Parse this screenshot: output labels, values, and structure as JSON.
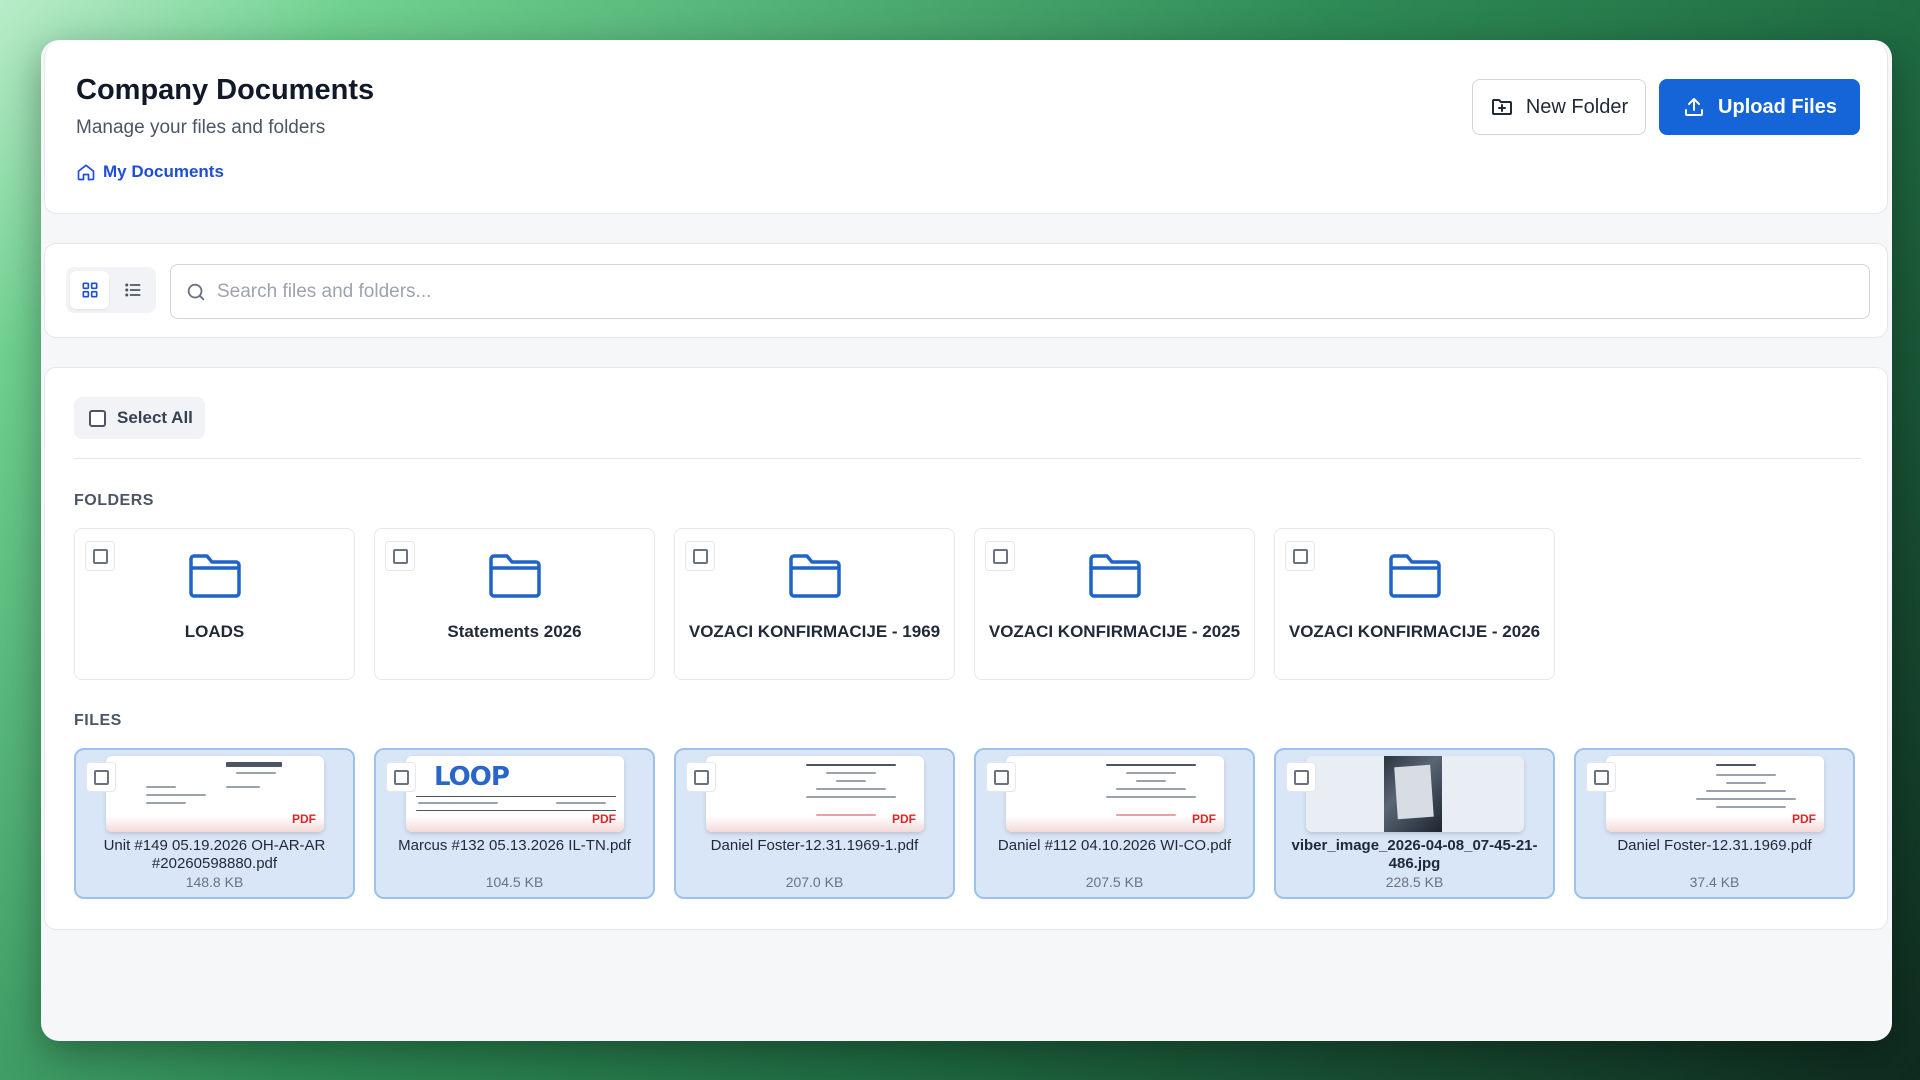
{
  "header": {
    "title": "Company Documents",
    "subtitle": "Manage your files and folders",
    "breadcrumb": "My Documents",
    "new_folder_label": "New Folder",
    "upload_label": "Upload Files"
  },
  "toolbar": {
    "views": [
      {
        "name": "grid",
        "active": true
      },
      {
        "name": "list",
        "active": false
      }
    ],
    "search_placeholder": "Search files and folders...",
    "search_value": ""
  },
  "main": {
    "select_all_label": "Select All",
    "folders_label": "FOLDERS",
    "files_label": "FILES",
    "folders": [
      {
        "name": "LOADS"
      },
      {
        "name": "Statements 2026"
      },
      {
        "name": "VOZACI KONFIRMACIJE - 1969"
      },
      {
        "name": "VOZACI KONFIRMACIJE - 2025"
      },
      {
        "name": "VOZACI KONFIRMACIJE - 2026"
      }
    ],
    "files": [
      {
        "name": "Unit #149 05.19.2026 OH-AR-AR #20260598880.pdf",
        "size": "148.8 KB",
        "type": "PDF"
      },
      {
        "name": "Marcus #132 05.13.2026 IL-TN.pdf",
        "size": "104.5 KB",
        "type": "PDF"
      },
      {
        "name": "Daniel Foster-12.31.1969-1.pdf",
        "size": "207.0 KB",
        "type": "PDF"
      },
      {
        "name": "Daniel #112 04.10.2026 WI-CO.pdf",
        "size": "207.5 KB",
        "type": "PDF"
      },
      {
        "name": "viber_image_2026-04-08_07-45-21-486.jpg",
        "size": "228.5 KB",
        "type": "image"
      },
      {
        "name": "Daniel Foster-12.31.1969.pdf",
        "size": "37.4 KB",
        "type": "PDF"
      }
    ],
    "thumb_text": {
      "loop_logo": "LOOP"
    }
  },
  "colors": {
    "accent": "#1565d8",
    "link": "#1d4ed8",
    "folder_icon": "#1e64c8",
    "pdf_tag": "#dc2626",
    "selected_card": "#d9e6f7"
  }
}
